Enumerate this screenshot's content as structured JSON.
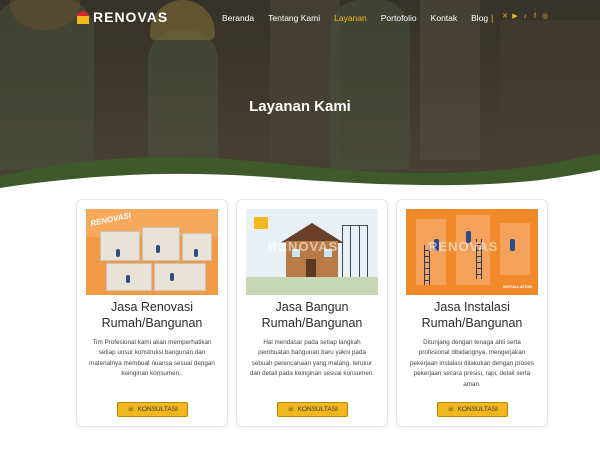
{
  "brand": {
    "name": "RENOVAS"
  },
  "nav": {
    "items": [
      {
        "label": "Beranda",
        "active": false
      },
      {
        "label": "Tentang Kami",
        "active": false
      },
      {
        "label": "Layanan",
        "active": true
      },
      {
        "label": "Portofolio",
        "active": false
      },
      {
        "label": "Kontak",
        "active": false
      },
      {
        "label": "Blog",
        "active": false
      }
    ],
    "separator": "|",
    "socials": [
      {
        "icon": "x-icon",
        "glyph": "✕"
      },
      {
        "icon": "youtube-icon",
        "glyph": "▶"
      },
      {
        "icon": "tiktok-icon",
        "glyph": "♪"
      },
      {
        "icon": "facebook-icon",
        "glyph": "f"
      },
      {
        "icon": "instagram-icon",
        "glyph": "◎"
      }
    ]
  },
  "hero": {
    "title": "Layanan Kami"
  },
  "cards": [
    {
      "title": "Jasa Renovasi Rumah/Bangunan",
      "text": "Tim Profesional kami akan memperhatikan setiap unsur konstruksi bangunan dan materialnya membuat nuansa sesuai dengan keinginan konsumen..",
      "image_tag": "RENOVASI",
      "button": "KONSULTASI"
    },
    {
      "title": "Jasa Bangun Rumah/Bangunan",
      "text": "Hal mendasar pada setiap langkah pembuatan bangunan baru yakni pada sebuah perencanaan yang matang, terukur dan detail pada keinginan sesuai konsumen.",
      "image_watermark": "RENOVAS",
      "button": "KONSULTASI"
    },
    {
      "title": "Jasa Instalasi Rumah/Bangunan",
      "text": "Ditunjang dengan tenaga ahli serta profesional dibidangnya, mengerjakan pekerjaan instalasi dilakukan dengan proses pekerjaan secara presisi, rapi, detail serta aman.",
      "image_watermark": "RENOVAS",
      "image_label": "INSTALLATION",
      "button": "KONSULTASI"
    }
  ],
  "colors": {
    "accent": "#f2b81d",
    "hero_green": "#3e5a2c",
    "text": "#2b2b2b"
  }
}
